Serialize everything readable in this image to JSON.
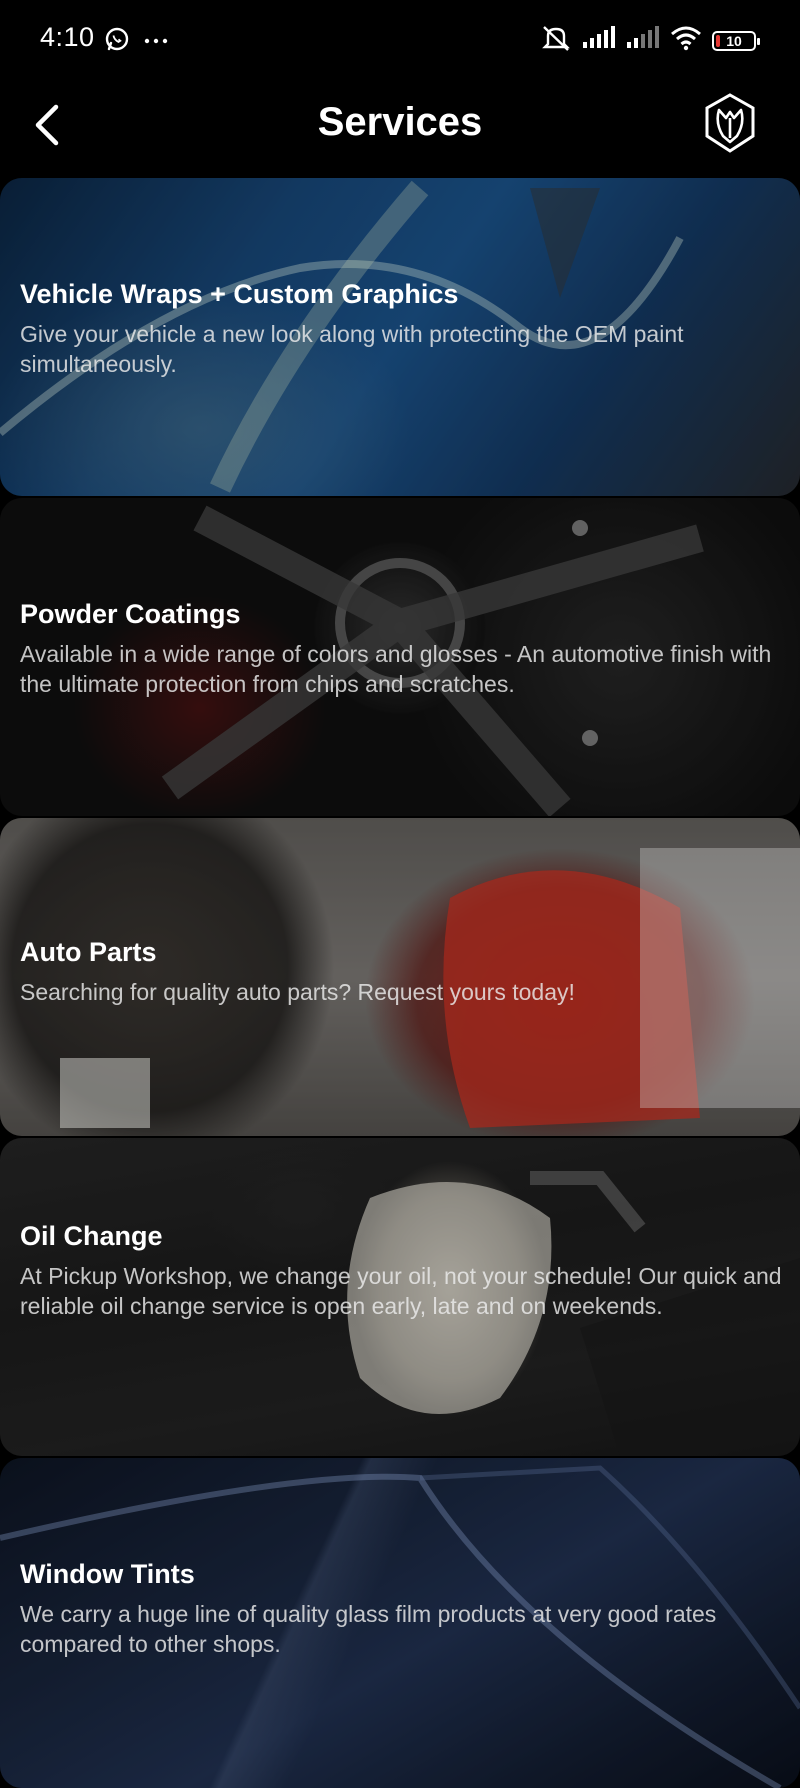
{
  "status_bar": {
    "time": "4:10",
    "battery": "10",
    "battery_level": 0.1,
    "battery_color": "#e53935",
    "icons_left": [
      "whatsapp-icon",
      "more-icon"
    ],
    "icons_right": [
      "silent-icon",
      "signal-icon",
      "signal-icon",
      "wifi-icon",
      "battery-icon"
    ]
  },
  "header": {
    "title": "Services",
    "back_icon": "chevron-left-icon",
    "logo_icon": "brand-logo-icon"
  },
  "services": [
    {
      "title": "Vehicle Wraps + Custom Graphics",
      "description": "Give your vehicle a new look along with protecting the OEM paint simultaneously."
    },
    {
      "title": "Powder Coatings",
      "description": "Available in a wide range of colors and glosses - An automotive finish with the ultimate protection from chips and scratches."
    },
    {
      "title": "Auto Parts",
      "description": "Searching for quality auto parts? Request yours today!"
    },
    {
      "title": "Oil Change",
      "description": "At Pickup Workshop, we change your oil, not your schedule! Our quick and reliable oil change service is open early, late and on weekends."
    },
    {
      "title": "Window Tints",
      "description": "We carry a huge line of quality glass film products at very good rates compared to other shops."
    }
  ]
}
